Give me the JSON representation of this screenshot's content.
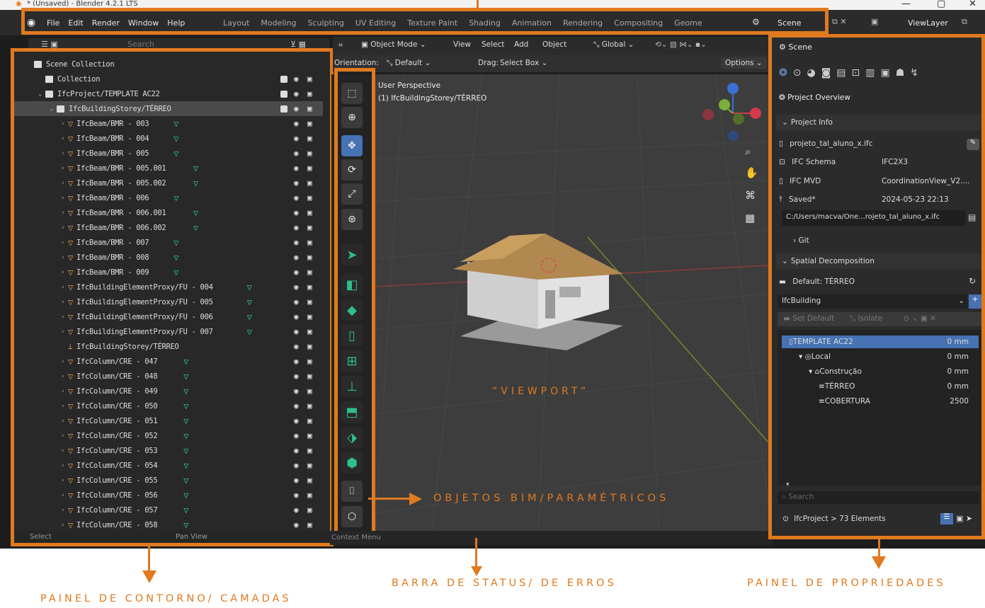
{
  "window": {
    "title": "* (Unsaved) - Blender 4.2.1 LTS",
    "min": "—",
    "max": "▢",
    "close": "✕"
  },
  "menu": [
    "File",
    "Edit",
    "Render",
    "Window",
    "Help"
  ],
  "workspaces": [
    "Layout",
    "Modeling",
    "Sculpting",
    "UV Editing",
    "Texture Paint",
    "Shading",
    "Animation",
    "Rendering",
    "Compositing",
    "Geome"
  ],
  "scene_name": "Scene",
  "viewlayer": "ViewLayer",
  "outliner": {
    "search_placeholder": "Search",
    "rows": [
      {
        "label": "Scene Collection",
        "indent": 0,
        "kind": "coll"
      },
      {
        "label": "Collection",
        "indent": 1,
        "kind": "coll"
      },
      {
        "label": "IfcProject/TEMPLATE AC22",
        "indent": 1,
        "kind": "coll"
      },
      {
        "label": "IfcBuildingStorey/TÉRREO",
        "indent": 2,
        "kind": "coll"
      },
      {
        "label": "IfcBeam/BMR - 003",
        "indent": 3,
        "kind": "obj"
      },
      {
        "label": "IfcBeam/BMR - 004",
        "indent": 3,
        "kind": "obj"
      },
      {
        "label": "IfcBeam/BMR - 005",
        "indent": 3,
        "kind": "obj"
      },
      {
        "label": "IfcBeam/BMR - 005.001",
        "indent": 3,
        "kind": "obj"
      },
      {
        "label": "IfcBeam/BMR - 005.002",
        "indent": 3,
        "kind": "obj"
      },
      {
        "label": "IfcBeam/BMR - 006",
        "indent": 3,
        "kind": "obj"
      },
      {
        "label": "IfcBeam/BMR - 006.001",
        "indent": 3,
        "kind": "obj"
      },
      {
        "label": "IfcBeam/BMR - 006.002",
        "indent": 3,
        "kind": "obj"
      },
      {
        "label": "IfcBeam/BMR - 007",
        "indent": 3,
        "kind": "obj"
      },
      {
        "label": "IfcBeam/BMR - 008",
        "indent": 3,
        "kind": "obj"
      },
      {
        "label": "IfcBeam/BMR - 009",
        "indent": 3,
        "kind": "obj"
      },
      {
        "label": "IfcBuildingElementProxy/FU - 004",
        "indent": 3,
        "kind": "obj"
      },
      {
        "label": "IfcBuildingElementProxy/FU - 005",
        "indent": 3,
        "kind": "obj"
      },
      {
        "label": "IfcBuildingElementProxy/FU - 006",
        "indent": 3,
        "kind": "obj"
      },
      {
        "label": "IfcBuildingElementProxy/FU - 007",
        "indent": 3,
        "kind": "obj"
      },
      {
        "label": "IfcBuildingStorey/TÉRREO",
        "indent": 3,
        "kind": "empty"
      },
      {
        "label": "IfcColumn/CRE - 047",
        "indent": 3,
        "kind": "obj"
      },
      {
        "label": "IfcColumn/CRE - 048",
        "indent": 3,
        "kind": "obj"
      },
      {
        "label": "IfcColumn/CRE - 049",
        "indent": 3,
        "kind": "obj"
      },
      {
        "label": "IfcColumn/CRE - 050",
        "indent": 3,
        "kind": "obj"
      },
      {
        "label": "IfcColumn/CRE - 051",
        "indent": 3,
        "kind": "obj"
      },
      {
        "label": "IfcColumn/CRE - 052",
        "indent": 3,
        "kind": "obj"
      },
      {
        "label": "IfcColumn/CRE - 053",
        "indent": 3,
        "kind": "obj"
      },
      {
        "label": "IfcColumn/CRE - 054",
        "indent": 3,
        "kind": "obj"
      },
      {
        "label": "IfcColumn/CRE - 055",
        "indent": 3,
        "kind": "obj"
      },
      {
        "label": "IfcColumn/CRE - 056",
        "indent": 3,
        "kind": "obj"
      },
      {
        "label": "IfcColumn/CRE - 057",
        "indent": 3,
        "kind": "obj"
      },
      {
        "label": "IfcColumn/CRE - 058",
        "indent": 3,
        "kind": "obj"
      }
    ],
    "footer_select": "Select",
    "footer_pan": "Pan View"
  },
  "viewport": {
    "mode": "Object Mode",
    "menus": [
      "View",
      "Select",
      "Add",
      "Object"
    ],
    "transform": "Global",
    "orientation_label": "Orientation:",
    "orientation_value": "Default",
    "drag_label": "Drag:",
    "drag_value": "Select Box",
    "options": "Options",
    "perspective": "User Perspective",
    "active": "(1) IfcBuildingStorey/TÉRREO",
    "label": "“VIEWPORT”",
    "context_menu": "Context Menu"
  },
  "properties": {
    "scene": "Scene",
    "panel_title": "Project Overview",
    "project_info": "Project Info",
    "file": "projeto_tal_aluno_x.ifc",
    "schema_label": "IFC Schema",
    "schema_value": "IFC2X3",
    "mvd_label": "IFC MVD",
    "mvd_value": "CoordinationView_V2....",
    "saved_label": "Saved*",
    "saved_value": "2024-05-23 22:13",
    "path": "C:/Users/macva/One...rojeto_tal_aluno_x.ifc",
    "git": "Git",
    "spatial": "Spatial Decomposition",
    "default": "Default: TÉRREO",
    "ifc_building": "IfcBuilding",
    "set_default": "Set Default",
    "isolate": "Isolate",
    "tree": [
      {
        "label": "TEMPLATE AC22",
        "value": "0 mm",
        "indent": 0,
        "sel": true
      },
      {
        "label": "Local",
        "value": "0 mm",
        "indent": 1,
        "sel": false
      },
      {
        "label": "Construção",
        "value": "0 mm",
        "indent": 2,
        "sel": false
      },
      {
        "label": "TÉRREO",
        "value": "0 mm",
        "indent": 3,
        "sel": false
      },
      {
        "label": "COBERTURA",
        "value": "2500",
        "indent": 3,
        "sel": false
      }
    ],
    "search_placeholder": "Search",
    "footer": "IfcProject > 73 Elements"
  },
  "annotations": {
    "outliner": "PAINEL DE CONTORNO/ CAMADAS",
    "status": "BARRA DE STATUS/ DE ERROS",
    "properties": "PAINEL DE PROPRIEDADES",
    "bim": "OBJETOS BIM/PARAMÉTRICOS"
  },
  "colors": {
    "accent": "#e07a1f",
    "select": "#4772b3",
    "mesh": "#2fbf8a"
  }
}
